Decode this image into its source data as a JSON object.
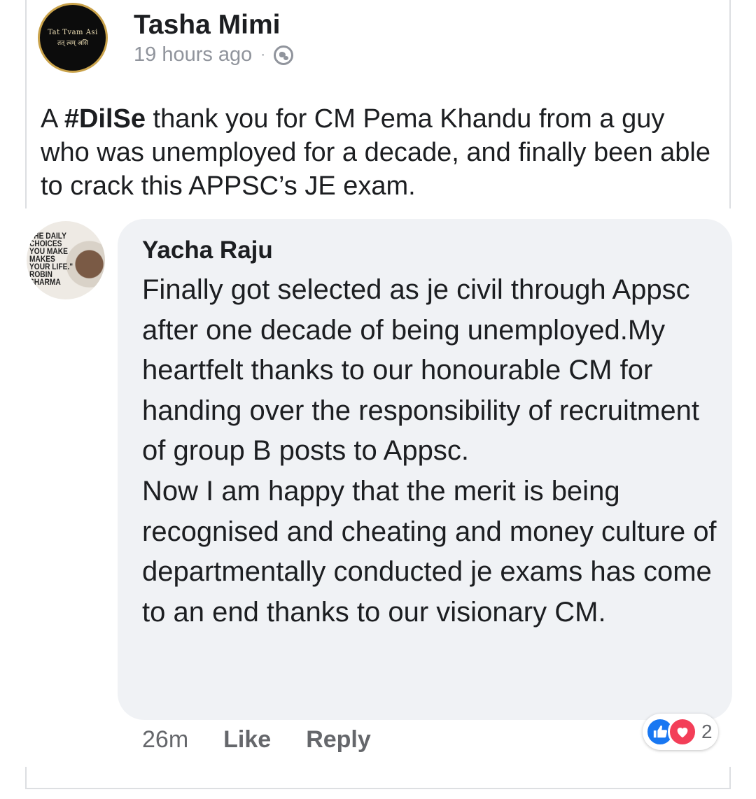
{
  "post": {
    "author": "Tasha Mimi",
    "avatar_text_line1": "Tat Tvam Asi",
    "avatar_text_line2": "तत् त्वम् असि",
    "timestamp": "19 hours ago",
    "separator": "·",
    "privacy_icon": "globe-icon",
    "text_prefix": "A ",
    "hashtag": "#DilSe",
    "text_body": " thank you for CM Pema Khandu from a guy who was unemployed for a decade, and finally been able to crack this APPSC’s JE exam."
  },
  "comment": {
    "author": "Yacha Raju",
    "avatar_quote": "THE DAILY CHOICES YOU MAKE MAKES YOUR LIFE.\" ROBIN SHARMA",
    "paragraph1": "Finally got selected as je civil through Appsc after one decade of being unemployed.My heartfelt thanks to our honourable CM for handing over the responsibility of recruitment of group B posts to Appsc.",
    "paragraph2": "Now I am happy that the merit is being recognised and cheating and money culture of departmentally conducted je exams has come to an end thanks to our visionary CM.",
    "time": "26m",
    "like_label": "Like",
    "reply_label": "Reply",
    "reactions": {
      "icons": [
        "like-icon",
        "love-icon"
      ],
      "count": "2"
    }
  },
  "colors": {
    "bubble_bg": "#f0f2f5",
    "meta_gray": "#90949c",
    "like_blue": "#1877f2",
    "love_red": "#f33e58"
  }
}
